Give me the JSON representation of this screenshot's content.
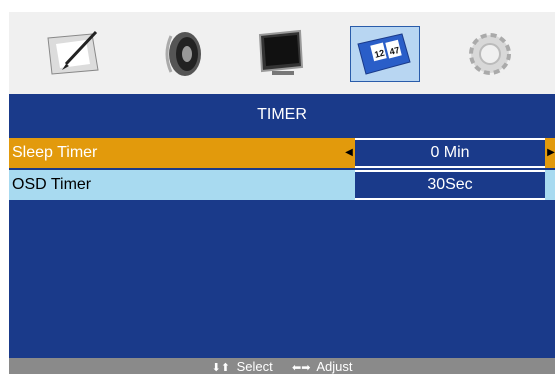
{
  "menu": {
    "tabs": [
      {
        "name": "picture",
        "icon": "picture-pen-icon",
        "selected": false
      },
      {
        "name": "sound",
        "icon": "speaker-icon",
        "selected": false
      },
      {
        "name": "screen",
        "icon": "monitor-icon",
        "selected": false
      },
      {
        "name": "timer",
        "icon": "clock-flip-icon",
        "selected": true
      },
      {
        "name": "setup",
        "icon": "gear-icon",
        "selected": false
      }
    ],
    "title": "TIMER",
    "rows": [
      {
        "label": "Sleep Timer",
        "value": "0 Min",
        "highlighted": true
      },
      {
        "label": "OSD Timer",
        "value": "30Sec",
        "highlighted": false
      }
    ]
  },
  "footer": {
    "select_label": "Select",
    "adjust_label": "Adjust"
  },
  "colors": {
    "background": "#1a3a8a",
    "highlight": "#e29a0c",
    "row_secondary": "#a8daf0",
    "footer": "#8a8a8a"
  },
  "clock_icon_text": {
    "left": "12",
    "right": "47"
  }
}
